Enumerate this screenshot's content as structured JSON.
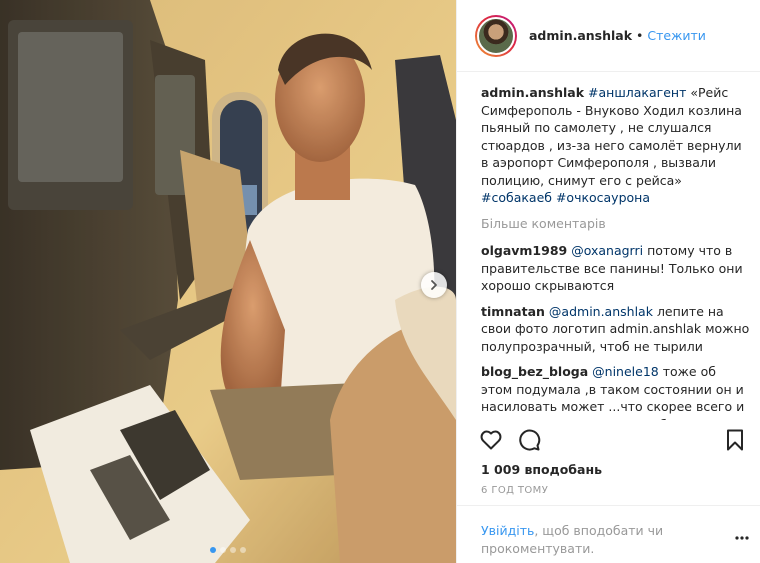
{
  "post": {
    "username": "admin.anshlak",
    "follow_label": "Стежити",
    "caption": {
      "username": "admin.anshlak",
      "tag": "#аншлакагент",
      "text": "«Рейс Симферополь - Внуково Ходил козлина пьяный по самолету , не слушался стюардов , из-за него самолёт вернули в аэропорт Симферополя , вызвали полицию, снимут его с рейса»",
      "tags_end": "#собакаеб #очкосаурона"
    },
    "more_comments": "Більше коментарів",
    "comments": [
      {
        "username": "olgavm1989",
        "mention": "@oxanagrri",
        "text": "потому что в правительстве все панины! Только они хорошо скрываются"
      },
      {
        "username": "timnatan",
        "mention": "@admin.anshlak",
        "text": "лепите на свои фото логотип admin.anshlak можно полупрозрачный, чтоб не тырили"
      },
      {
        "username": "blog_bez_bloga",
        "mention": "@ninele18",
        "text": "тоже об этом подумала ,в таком состоянии он и насиловать может ...что скорее всего и происходит ,учитывая его больные"
      }
    ],
    "likes": "1 009 вподобань",
    "time": "6 год тому",
    "login_link": "Увійдіть",
    "login_text": ", щоб вподобати чи прокоментувати."
  },
  "carousel": {
    "count": 4,
    "active_index": 0
  },
  "icons": [
    "heart-icon",
    "comment-icon",
    "bookmark-icon",
    "chevron-right-icon",
    "more-options-icon"
  ],
  "colors": {
    "link_blue": "#3897f0",
    "hashtag": "#003569",
    "muted": "#999999",
    "text": "#262626"
  }
}
